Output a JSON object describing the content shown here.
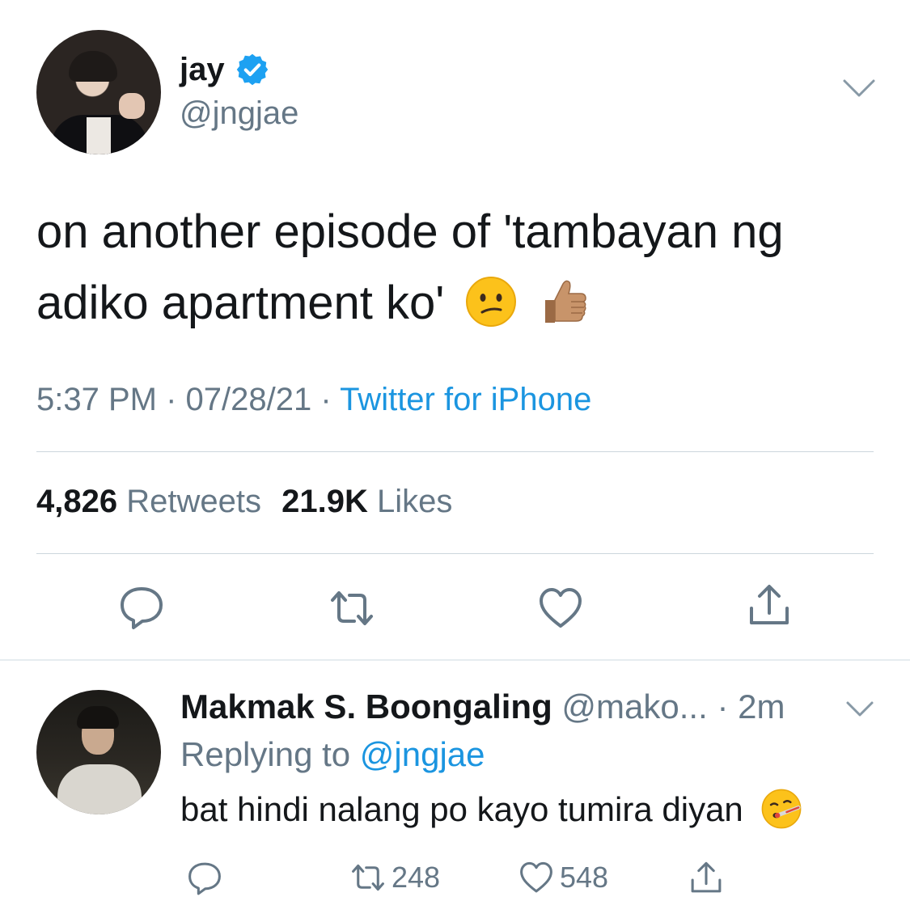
{
  "tweet": {
    "display_name": "jay",
    "verified": true,
    "handle": "@jngjae",
    "text_line1": "on another episode of 'tambayan ng",
    "text_line2": "adiko apartment ko'",
    "emojis": [
      "confused-face",
      "thumbs-up-medium-skin-tone"
    ],
    "time": "5:37 PM",
    "date": "07/28/21",
    "source": "Twitter for iPhone",
    "retweets_count": "4,826",
    "retweets_label": "Retweets",
    "likes_count": "21.9K",
    "likes_label": "Likes",
    "actions": [
      "reply-icon",
      "retweet-icon",
      "like-icon",
      "share-icon"
    ]
  },
  "reply": {
    "display_name": "Makmak S. Boongaling",
    "handle": "@mako...",
    "time": "· 2m",
    "replying_prefix": "Replying to",
    "replying_to": "@jngjae",
    "text": "bat hindi nalang po kayo tumira diyan",
    "emoji": "face-with-thermometer",
    "retweets": "248",
    "likes": "548"
  },
  "colors": {
    "text": "#14171a",
    "secondary": "#657786",
    "link": "#1b95e0",
    "verified": "#1da1f2",
    "divider": "#ccd6dd"
  }
}
